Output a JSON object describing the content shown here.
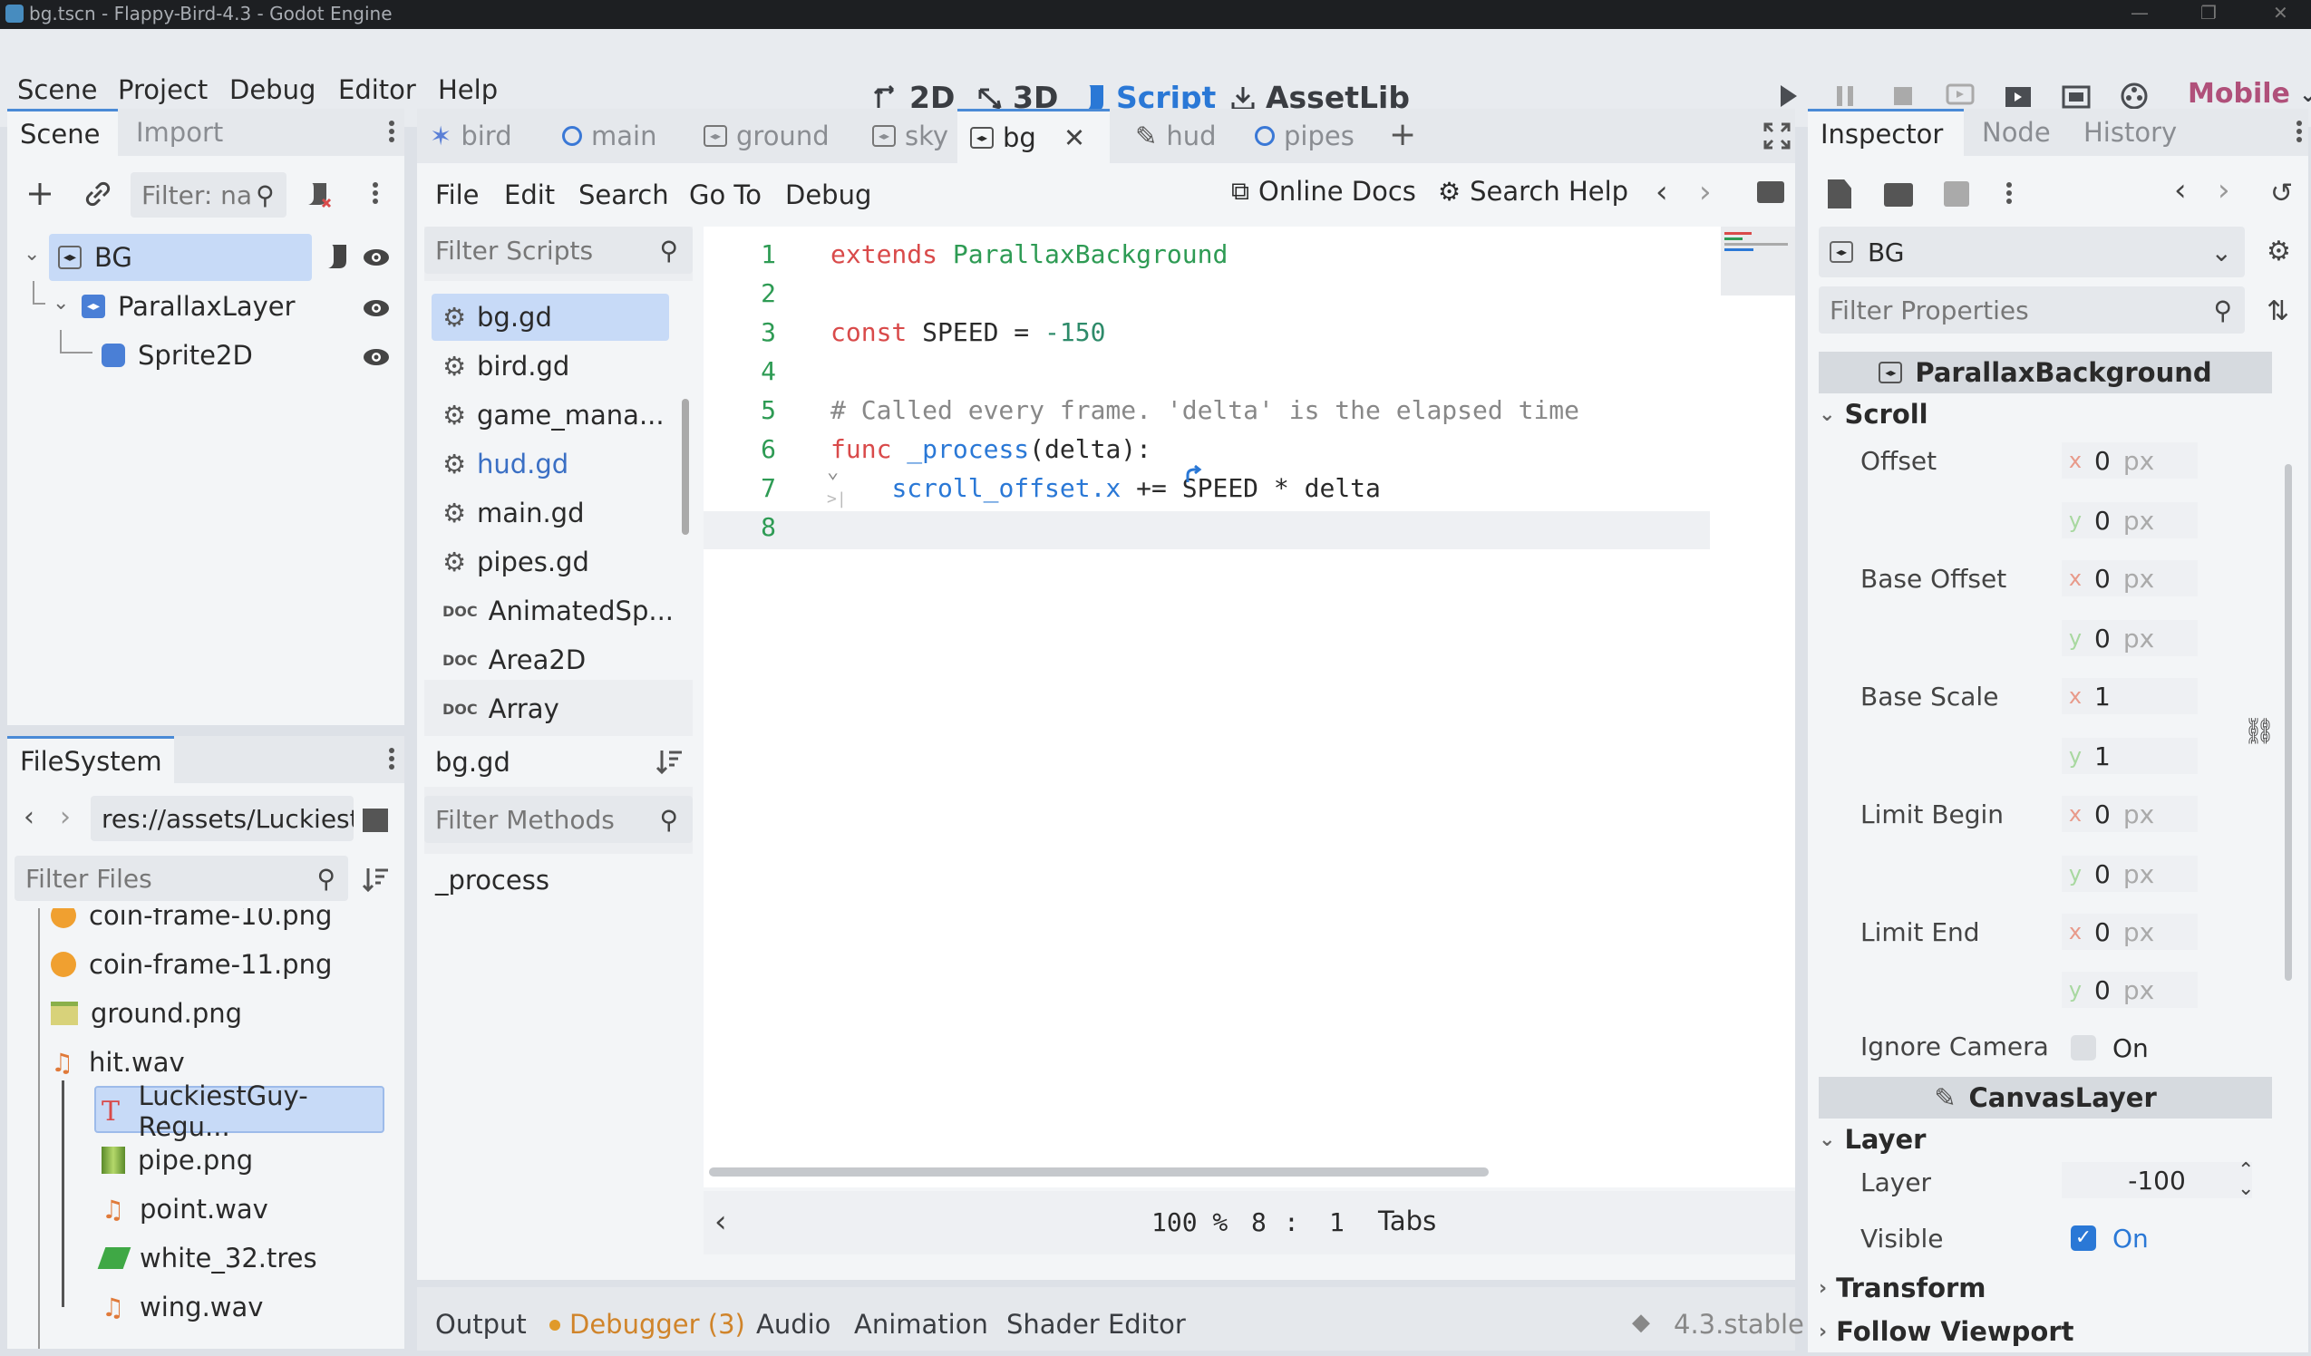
{
  "window": {
    "title": "bg.tscn - Flappy-Bird-4.3 - Godot Engine"
  },
  "menu": {
    "items": [
      "Scene",
      "Project",
      "Debug",
      "Editor",
      "Help"
    ]
  },
  "workspaces": {
    "items": [
      "2D",
      "3D",
      "Script",
      "AssetLib"
    ],
    "active": "Script"
  },
  "renderer": {
    "label": "Mobile"
  },
  "scene_dock": {
    "tabs": [
      "Scene",
      "Import"
    ],
    "filter_placeholder": "Filter: na",
    "nodes": [
      {
        "name": "BG",
        "type": "ParallaxBackground"
      },
      {
        "name": "ParallaxLayer",
        "type": "ParallaxLayer"
      },
      {
        "name": "Sprite2D",
        "type": "Sprite2D"
      }
    ]
  },
  "filesystem": {
    "tab": "FileSystem",
    "path": "res://assets/Luckiest",
    "filter_placeholder": "Filter Files",
    "files": [
      "coin-frame-10.png",
      "coin-frame-11.png",
      "ground.png",
      "hit.wav",
      "LuckiestGuy-Regu...",
      "pipe.png",
      "point.wav",
      "white_32.tres",
      "wing.wav"
    ]
  },
  "scene_tabs": {
    "items": [
      "bird",
      "main",
      "ground",
      "sky",
      "bg",
      "hud",
      "pipes"
    ],
    "active": "bg"
  },
  "script_menu": {
    "items": [
      "File",
      "Edit",
      "Search",
      "Go To",
      "Debug"
    ],
    "online_docs": "Online Docs",
    "search_help": "Search Help"
  },
  "script_list": {
    "filter_placeholder": "Filter Scripts",
    "items": [
      {
        "name": "bg.gd",
        "kind": "script"
      },
      {
        "name": "bird.gd",
        "kind": "script"
      },
      {
        "name": "game_mana...",
        "kind": "script"
      },
      {
        "name": "hud.gd",
        "kind": "script"
      },
      {
        "name": "main.gd",
        "kind": "script"
      },
      {
        "name": "pipes.gd",
        "kind": "script"
      },
      {
        "name": "AnimatedSp...",
        "kind": "doc"
      },
      {
        "name": "Area2D",
        "kind": "doc"
      },
      {
        "name": "Array",
        "kind": "doc"
      }
    ],
    "current": "bg.gd",
    "methods_placeholder": "Filter Methods",
    "methods": [
      "_process"
    ]
  },
  "code": {
    "lines": [
      {
        "n": "1",
        "parts": [
          [
            "kw",
            "extends"
          ],
          [
            "txt",
            " "
          ],
          [
            "cls",
            "ParallaxBackground"
          ]
        ]
      },
      {
        "n": "2",
        "parts": []
      },
      {
        "n": "3",
        "parts": [
          [
            "kw",
            "const"
          ],
          [
            "txt",
            " SPEED = "
          ],
          [
            "num",
            "-150"
          ]
        ]
      },
      {
        "n": "4",
        "parts": []
      },
      {
        "n": "5",
        "parts": [
          [
            "cmt",
            "# Called every frame. 'delta' is the elapsed time"
          ]
        ]
      },
      {
        "n": "6",
        "parts": [
          [
            "kw",
            "func"
          ],
          [
            "txt",
            " "
          ],
          [
            "fn",
            "_process"
          ],
          [
            "txt",
            "(delta):"
          ]
        ]
      },
      {
        "n": "7",
        "parts": [
          [
            "txt",
            "    "
          ],
          [
            "fn",
            "scroll_offset.x"
          ],
          [
            "txt",
            " += SPEED * delta"
          ]
        ]
      },
      {
        "n": "8",
        "parts": []
      }
    ]
  },
  "status": {
    "zoom": "100 %",
    "line": "8",
    "sep": ":",
    "col": "1",
    "indent": "Tabs"
  },
  "bottom_panel": {
    "tabs": [
      "Output",
      "Debugger (3)",
      "Audio",
      "Animation",
      "Shader Editor"
    ],
    "version": "4.3.stable"
  },
  "inspector": {
    "tabs": [
      "Inspector",
      "Node",
      "History"
    ],
    "node": "BG",
    "filter_placeholder": "Filter Properties",
    "class_header": "ParallaxBackground",
    "scroll_group": "Scroll",
    "props": [
      {
        "label": "Offset",
        "x": "0",
        "y": "0",
        "unit": "px"
      },
      {
        "label": "Base Offset",
        "x": "0",
        "y": "0",
        "unit": "px"
      },
      {
        "label": "Base Scale",
        "x": "1",
        "y": "1",
        "unit": ""
      },
      {
        "label": "Limit Begin",
        "x": "0",
        "y": "0",
        "unit": "px"
      },
      {
        "label": "Limit End",
        "x": "0",
        "y": "0",
        "unit": "px"
      }
    ],
    "ignore_camera": {
      "label": "Ignore Camera",
      "value": "On",
      "checked": false
    },
    "canvas_header": "CanvasLayer",
    "layer_group": "Layer",
    "layer": {
      "label": "Layer",
      "value": "-100"
    },
    "visible": {
      "label": "Visible",
      "value": "On",
      "checked": true
    },
    "more_groups": [
      "Transform",
      "Follow Viewport"
    ]
  },
  "colors": {
    "accent": "#2a78d6",
    "selection": "#c7daf7",
    "keyword": "#d94a4a",
    "type": "#2e9b54"
  }
}
